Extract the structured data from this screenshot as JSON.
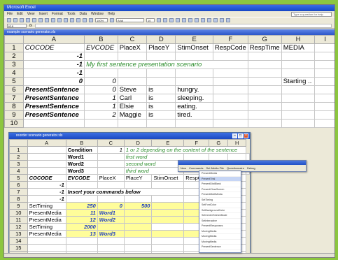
{
  "app": {
    "title": "Microsoft Excel",
    "menu": [
      "File",
      "Edit",
      "View",
      "Insert",
      "Format",
      "Tools",
      "Data",
      "Window",
      "Help"
    ],
    "ask_placeholder": "Type a question for help",
    "font_name": "Arial",
    "font_size": "10",
    "zoom": "100%",
    "name_box": "K19"
  },
  "sheet1": {
    "title": "example scenario generator.xls",
    "columns": [
      "",
      "A",
      "B",
      "C",
      "D",
      "E",
      "F",
      "G",
      "H",
      "I"
    ],
    "rows": [
      {
        "n": "1",
        "a": "COCODE",
        "b": "EVCODE",
        "c": "PlaceX",
        "d": "PlaceY",
        "e": "StimOnset",
        "f": "RespCode",
        "g": "RespTime",
        "h": "MEDIA",
        "i": ""
      },
      {
        "n": "2",
        "a": "-1",
        "b": "",
        "c": "",
        "d": "",
        "e": "",
        "f": "",
        "g": "",
        "h": "",
        "i": ""
      },
      {
        "n": "3",
        "a": "-1",
        "b": "My first sentence presentation scenario",
        "c": "",
        "d": "",
        "e": "",
        "f": "",
        "g": "",
        "h": "",
        "i": ""
      },
      {
        "n": "4",
        "a": "-1",
        "b": "",
        "c": "",
        "d": "",
        "e": "",
        "f": "",
        "g": "",
        "h": "",
        "i": ""
      },
      {
        "n": "5",
        "a": "0",
        "b": "0",
        "c": "",
        "d": "",
        "e": "",
        "f": "",
        "g": "",
        "h": "Starting ..",
        "i": ""
      },
      {
        "n": "6",
        "a": "PresentSentence",
        "b": "0",
        "c": "Steve",
        "d": "is",
        "e": "hungry.",
        "f": "",
        "g": "",
        "h": "",
        "i": ""
      },
      {
        "n": "7",
        "a": "PresentSentence",
        "b": "1",
        "c": "Carl",
        "d": "is",
        "e": "sleeping.",
        "f": "",
        "g": "",
        "h": "",
        "i": ""
      },
      {
        "n": "8",
        "a": "PresentSentence",
        "b": "1",
        "c": "Elsie",
        "d": "is",
        "e": "eating.",
        "f": "",
        "g": "",
        "h": "",
        "i": ""
      },
      {
        "n": "9",
        "a": "PresentSentence",
        "b": "2",
        "c": "Maggie",
        "d": "is",
        "e": "tired.",
        "f": "",
        "g": "",
        "h": "",
        "i": ""
      },
      {
        "n": "10",
        "a": "",
        "b": "",
        "c": "",
        "d": "",
        "e": "",
        "f": "",
        "g": "",
        "h": "",
        "i": ""
      }
    ]
  },
  "sheet2": {
    "title": "reorder scenario generator.xls",
    "columns": [
      "",
      "A",
      "B",
      "C",
      "D",
      "E",
      "F",
      "G",
      "H"
    ],
    "rows": [
      {
        "n": "1",
        "a": "",
        "b": "Condition",
        "c": "1",
        "d": "1 or 2 depending on the content of the sentence",
        "e": "",
        "f": "",
        "g": "",
        "h": ""
      },
      {
        "n": "2",
        "a": "",
        "b": "Word1",
        "c": "",
        "d": "first word",
        "e": "",
        "f": "",
        "g": "",
        "h": ""
      },
      {
        "n": "3",
        "a": "",
        "b": "Word2",
        "c": "",
        "d": "second word",
        "e": "",
        "f": "",
        "g": "",
        "h": ""
      },
      {
        "n": "4",
        "a": "",
        "b": "Word3",
        "c": "",
        "d": "third word",
        "e": "",
        "f": "",
        "g": "",
        "h": ""
      },
      {
        "n": "5",
        "a": "COCODE",
        "b": "EVCODE",
        "c": "PlaceX",
        "d": "PlaceY",
        "e": "StimOnset",
        "f": "RespCo",
        "g": "",
        "h": "IA"
      },
      {
        "n": "6",
        "a": "-1",
        "b": "",
        "c": "",
        "d": "",
        "e": "",
        "f": "",
        "g": "",
        "h": ""
      },
      {
        "n": "7",
        "a": "-1",
        "b": "Insert your commands below",
        "c": "",
        "d": "",
        "e": "",
        "f": "",
        "g": "",
        "h": ""
      },
      {
        "n": "8",
        "a": "-1",
        "b": "",
        "c": "",
        "d": "",
        "e": "",
        "f": "",
        "g": "",
        "h": ""
      },
      {
        "n": "9",
        "a": "SetTiming",
        "b": "250",
        "c": "0",
        "d": "500",
        "e": "",
        "f": "",
        "g": "",
        "h": ""
      },
      {
        "n": "10",
        "a": "PresentMedia",
        "b": "11",
        "c": "Word1",
        "d": "",
        "e": "",
        "f": "",
        "g": "",
        "h": ""
      },
      {
        "n": "11",
        "a": "PresentMedia",
        "b": "12",
        "c": "Word2",
        "d": "",
        "e": "",
        "f": "",
        "g": "",
        "h": ""
      },
      {
        "n": "12",
        "a": "SetTiming",
        "b": "2000",
        "c": "",
        "d": "",
        "e": "",
        "f": "",
        "g": "",
        "h": ""
      },
      {
        "n": "13",
        "a": "PresentMedia",
        "b": "13",
        "c": "Word3",
        "d": "",
        "e": "",
        "f": "",
        "g": "",
        "h": ""
      },
      {
        "n": "14",
        "a": "",
        "b": "",
        "c": "",
        "d": "",
        "e": "",
        "f": "",
        "g": "",
        "h": ""
      },
      {
        "n": "15",
        "a": "",
        "b": "",
        "c": "",
        "d": "",
        "e": "",
        "f": "",
        "g": "",
        "h": ""
      },
      {
        "n": "16",
        "a": "",
        "b": "",
        "c": "",
        "d": "",
        "e": "",
        "f": "",
        "g": "",
        "h": ""
      }
    ]
  },
  "float_toolbar": {
    "items": [
      "New",
      "Commands",
      "Set Media File",
      "Questionnaire",
      "Debug"
    ]
  },
  "dropdown": {
    "items": [
      "PresentMedia",
      "PresentTrial",
      "PresentDistBlank",
      "PresentClearScreen",
      "PresentMultiMedia",
      "SetTiming",
      "SetFontColor",
      "SetBackgroundColor",
      "SetCenterStretchMode",
      "SetInteractive",
      "PresentResponses",
      "MovingMedia",
      "MovingMedia",
      "MovingMedia",
      "PresentSentence"
    ],
    "selected_index": 1
  }
}
